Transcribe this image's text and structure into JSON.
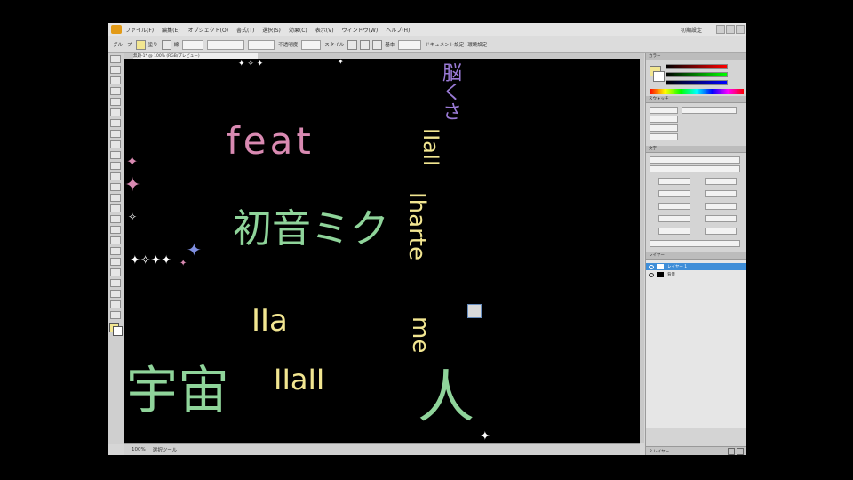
{
  "window": {
    "menu_items": [
      "ファイル(F)",
      "編集(E)",
      "オブジェクト(O)",
      "書式(T)",
      "選択(S)",
      "効果(C)",
      "表示(V)",
      "ウィンドウ(W)",
      "ヘルプ(H)"
    ],
    "workspace_label": "初期設定"
  },
  "control_bar": {
    "items": [
      "グループ",
      "塗り",
      "線",
      "不透明度",
      "スタイル",
      "基本",
      "ドキュメント設定",
      "環境設定"
    ]
  },
  "document": {
    "tab_label": "無題-1* @ 100% (RGB/プレビュー)",
    "status_zoom": "100%",
    "status_info": "選択ツール"
  },
  "canvas_text": {
    "feat": "feat",
    "hatsune": "初音ミク",
    "kanji_left": "宇宙",
    "kanji_right": "人",
    "col1": "IIaII",
    "col2": "Iharte",
    "col3": "me",
    "stack1": "IIa",
    "stack2": "IIaII",
    "top_right": "脳くさ"
  },
  "panels": {
    "color_title": "カラー",
    "swatch_title": "スウォッチ",
    "char_title": "文字",
    "layers_title": "レイヤー",
    "layer_1": "レイヤー 1",
    "layer_2": "背景",
    "layer_count": "2 レイヤー"
  },
  "colors": {
    "pink": "#d98ab2",
    "green": "#8fd49a",
    "yellow": "#f2e691",
    "blue": "#7f8fe0",
    "purple": "#9a7ad6",
    "selection": "#3f8ed8"
  }
}
